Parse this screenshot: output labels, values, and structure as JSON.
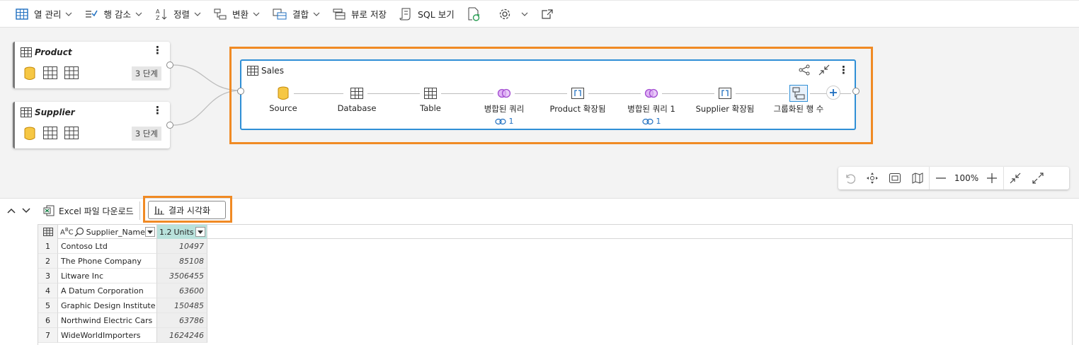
{
  "toolbar": {
    "columns": "열 관리",
    "reduce_rows": "행 감소",
    "sort": "정렬",
    "transform": "변환",
    "combine": "결합",
    "save_view": "뷰로 저장",
    "view_sql": "SQL 보기"
  },
  "queries": {
    "product": {
      "title": "Product",
      "steps": "3 단계"
    },
    "supplier": {
      "title": "Supplier",
      "steps": "3 단계"
    }
  },
  "sales": {
    "title": "Sales",
    "steps": [
      {
        "label": "Source",
        "icon": "database-icon"
      },
      {
        "label": "Database",
        "icon": "table-icon"
      },
      {
        "label": "Table",
        "icon": "table-icon"
      },
      {
        "label": "병합된 쿼리",
        "icon": "merge-icon",
        "link": "1"
      },
      {
        "label": "Product 확장됨",
        "icon": "expand-icon"
      },
      {
        "label": "병합된 쿼리 1",
        "icon": "merge-icon",
        "link": "1"
      },
      {
        "label": "Supplier 확장됨",
        "icon": "expand-icon"
      },
      {
        "label": "그룹화된 행 수",
        "icon": "group-icon"
      }
    ]
  },
  "zoom": {
    "value": "100%"
  },
  "panel": {
    "download_excel": "Excel 파일 다운로드",
    "visualize": "결과 시각화"
  },
  "grid": {
    "columns": [
      "Supplier_Name",
      "Units"
    ],
    "units_type": "1.2",
    "rows": [
      {
        "n": "1",
        "name": "Contoso Ltd",
        "units": "10497"
      },
      {
        "n": "2",
        "name": "The Phone Company",
        "units": "85108"
      },
      {
        "n": "3",
        "name": "Litware Inc",
        "units": "3506455"
      },
      {
        "n": "4",
        "name": "A Datum Corporation",
        "units": "63600"
      },
      {
        "n": "5",
        "name": "Graphic Design Institute",
        "units": "150485"
      },
      {
        "n": "6",
        "name": "Northwind Electric Cars",
        "units": "63786"
      },
      {
        "n": "7",
        "name": "WideWorldImporters",
        "units": "1624246"
      }
    ]
  },
  "colors": {
    "accent": "#2f8fd6",
    "highlight": "#f08a24",
    "merge": "#a24bd1",
    "db": "#e8a317"
  }
}
